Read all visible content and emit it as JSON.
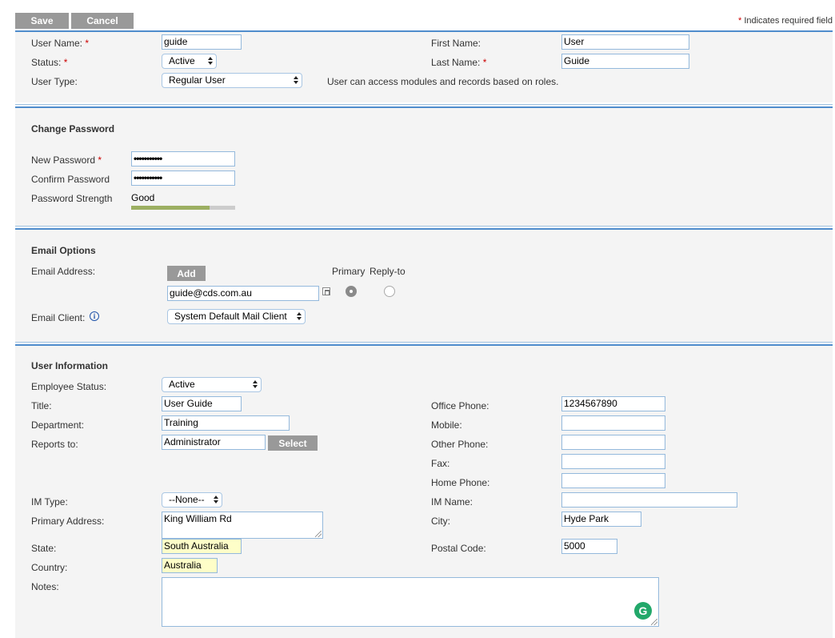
{
  "toolbar": {
    "save_label": "Save",
    "cancel_label": "Cancel",
    "required_note": "Indicates required field",
    "required_marker": "*"
  },
  "account": {
    "user_name_label": "User Name:",
    "user_name_value": "guide",
    "status_label": "Status:",
    "status_value": "Active",
    "user_type_label": "User Type:",
    "user_type_value": "Regular User",
    "user_type_hint": "User can access modules and records based on roles.",
    "first_name_label": "First Name:",
    "first_name_value": "User",
    "last_name_label": "Last Name:",
    "last_name_value": "Guide"
  },
  "password": {
    "heading": "Change Password",
    "new_label": "New Password",
    "new_value": "•••••••••••",
    "confirm_label": "Confirm Password",
    "confirm_value": "•••••••••••",
    "strength_label": "Password Strength",
    "strength_value": "Good",
    "strength_fraction": 0.75,
    "strength_color": "#9caf62"
  },
  "email": {
    "heading": "Email Options",
    "address_label": "Email Address:",
    "add_label": "Add",
    "primary_label": "Primary",
    "reply_to_label": "Reply-to",
    "address_value": "guide@cds.com.au",
    "primary_selected": true,
    "reply_to_selected": false,
    "client_label": "Email Client:",
    "client_info_icon": "i",
    "client_value": "System Default Mail Client"
  },
  "user_info": {
    "heading": "User Information",
    "employee_status_label": "Employee Status:",
    "employee_status_value": "Active",
    "title_label": "Title:",
    "title_value": "User Guide",
    "department_label": "Department:",
    "department_value": "Training",
    "reports_to_label": "Reports to:",
    "reports_to_value": "Administrator",
    "select_label": "Select",
    "office_phone_label": "Office Phone:",
    "office_phone_value": "1234567890",
    "mobile_label": "Mobile:",
    "mobile_value": "",
    "other_phone_label": "Other Phone:",
    "other_phone_value": "",
    "fax_label": "Fax:",
    "fax_value": "",
    "home_phone_label": "Home Phone:",
    "home_phone_value": "",
    "im_type_label": "IM Type:",
    "im_type_value": "--None--",
    "im_name_label": "IM Name:",
    "im_name_value": "",
    "primary_address_label": "Primary Address:",
    "primary_address_value": "King William Rd",
    "city_label": "City:",
    "city_value": "Hyde Park",
    "state_label": "State:",
    "state_value": "South Australia",
    "postal_code_label": "Postal Code:",
    "postal_code_value": "5000",
    "country_label": "Country:",
    "country_value": "Australia",
    "notes_label": "Notes:",
    "notes_value": "",
    "grammarly_glyph": "G"
  }
}
